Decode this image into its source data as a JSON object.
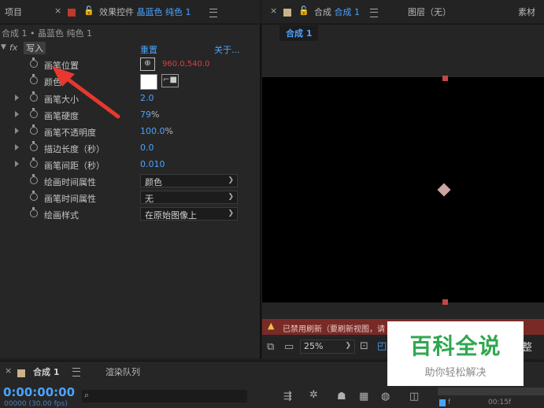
{
  "left_panel": {
    "tab_project": "项目",
    "tab_effects_prefix": "效果控件",
    "tab_effects_layer": "晶蓝色 纯色 1",
    "breadcrumb": "合成 1 • 晶蓝色 纯色 1",
    "fx_label": "fx",
    "effect_name": "写入",
    "reset_label": "重置",
    "about_label": "关于...",
    "properties": [
      {
        "label": "画笔位置",
        "value": "960.0,540.0"
      },
      {
        "label": "颜色"
      },
      {
        "label": "画笔大小",
        "value": "2.0"
      },
      {
        "label": "画笔硬度",
        "value": "79",
        "unit": "%"
      },
      {
        "label": "画笔不透明度",
        "value": "100.0",
        "unit": "%"
      },
      {
        "label": "描边长度（秒）",
        "value": "0.0"
      },
      {
        "label": "画笔间距（秒）",
        "value": "0.010"
      },
      {
        "label": "绘画时间属性",
        "value": "颜色"
      },
      {
        "label": "画笔时间属性",
        "value": "无"
      },
      {
        "label": "绘画样式",
        "value": "在原始图像上"
      }
    ],
    "brush_color": "#ffffff"
  },
  "right_panel": {
    "tab_comp_prefix": "合成",
    "tab_comp_name": "合成 1",
    "tab_layer": "图层（无）",
    "tab_footage": "素材",
    "sub_tab": "合成 1",
    "warning": "已禁用刷新（要刷新视图，请",
    "zoom": "25%"
  },
  "bottom_panel": {
    "tab_comp": "合成 1",
    "tab_render": "渲染队列",
    "timecode": "0:00:00:00",
    "fps": "00000 (30.00 fps)",
    "search_placeholder": "",
    "ruler_1": "f",
    "ruler_2": "00:15f",
    "complete_partial": "整"
  },
  "watermark": {
    "title": "百科全说",
    "subtitle": "助你轻松解决"
  },
  "colors": {
    "accent_blue": "#4aa3ff",
    "red_value": "#e03c3c",
    "solid_swatch": "#c0392b",
    "comp_swatch": "#c9b38a",
    "warning_bar": "#7a2a26",
    "watermark_green": "#2fa84f"
  }
}
